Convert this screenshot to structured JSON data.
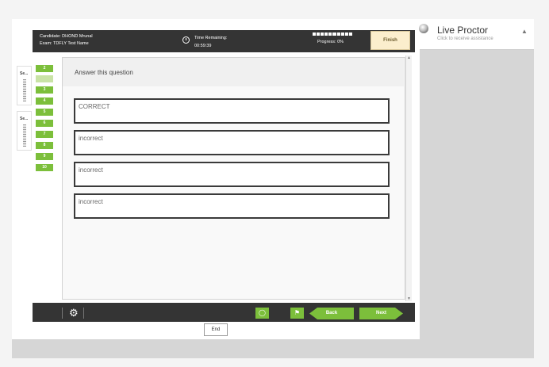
{
  "header": {
    "candidate": "Candidate: DHOND Mrunal",
    "exam": "Exam: TDFLY Test Name",
    "time_label": "Time Remaining:",
    "time_value": "00:59:39",
    "progress_text": "Progress: 0%",
    "progress_fraction": 0,
    "finish_label": "Finish"
  },
  "proctor": {
    "title": "Live Proctor",
    "subtitle": "Click to receive assistance"
  },
  "sections": [
    {
      "label": "Se..."
    },
    {
      "label": "Se..."
    }
  ],
  "questions": [
    "2",
    "3",
    "4",
    "5",
    "6",
    "7",
    "8",
    "9",
    "10"
  ],
  "current_question": "2",
  "question": {
    "prompt": "Answer this question",
    "answers": [
      "CORRECT",
      "incorrect",
      "incorrect",
      "incorrect"
    ]
  },
  "footer": {
    "back_label": "Back",
    "next_label": "Next",
    "end_label": "End"
  },
  "icons": {
    "clock": "clock-icon",
    "settings": "gear-icon",
    "chat": "chat-icon",
    "flag": "flag-icon",
    "proctor": "status-dot-icon",
    "collapse": "chevron-up-icon"
  },
  "colors": {
    "accent": "#7cbf3b",
    "header_bg": "#343434",
    "finish_bg": "#fbeecd"
  }
}
